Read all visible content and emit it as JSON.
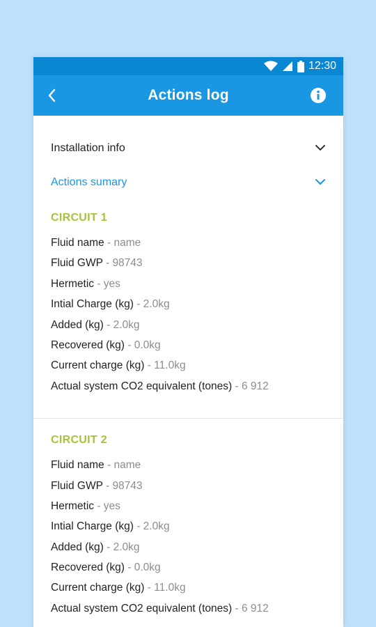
{
  "status_bar": {
    "time": "12:30"
  },
  "app_bar": {
    "title": "Actions log"
  },
  "sections": {
    "installation_info": "Installation info",
    "actions_summary": "Actions sumary"
  },
  "separator": " - ",
  "circuits": [
    {
      "title": "CIRCUIT 1",
      "rows": [
        {
          "label": "Fluid name",
          "value": "name"
        },
        {
          "label": "Fluid GWP",
          "value": "98743"
        },
        {
          "label": "Hermetic",
          "value": "yes"
        },
        {
          "label": "Intial Charge (kg)",
          "value": "2.0kg"
        },
        {
          "label": "Added (kg)",
          "value": "2.0kg"
        },
        {
          "label": "Recovered (kg)",
          "value": "0.0kg"
        },
        {
          "label": "Current charge (kg)",
          "value": "11.0kg"
        },
        {
          "label": "Actual system CO2 equivalent (tones)",
          "value": "6 912"
        }
      ]
    },
    {
      "title": "CIRCUIT 2",
      "rows": [
        {
          "label": "Fluid name",
          "value": "name"
        },
        {
          "label": "Fluid GWP",
          "value": "98743"
        },
        {
          "label": "Hermetic",
          "value": "yes"
        },
        {
          "label": "Intial Charge (kg)",
          "value": "2.0kg"
        },
        {
          "label": "Added (kg)",
          "value": "2.0kg"
        },
        {
          "label": "Recovered (kg)",
          "value": "0.0kg"
        },
        {
          "label": "Current charge (kg)",
          "value": "11.0kg"
        },
        {
          "label": "Actual system CO2 equivalent (tones)",
          "value": "6 912"
        }
      ]
    }
  ],
  "colors": {
    "primary": "#1a97e3",
    "status": "#0a87d3",
    "circuit_title": "#a7c23b",
    "background": "#bfe0fb"
  },
  "icons": {
    "back": "arrow-back-icon",
    "info": "info-icon",
    "wifi": "wifi-icon",
    "signal": "signal-icon",
    "battery": "battery-icon",
    "chevron": "chevron-down-icon"
  }
}
